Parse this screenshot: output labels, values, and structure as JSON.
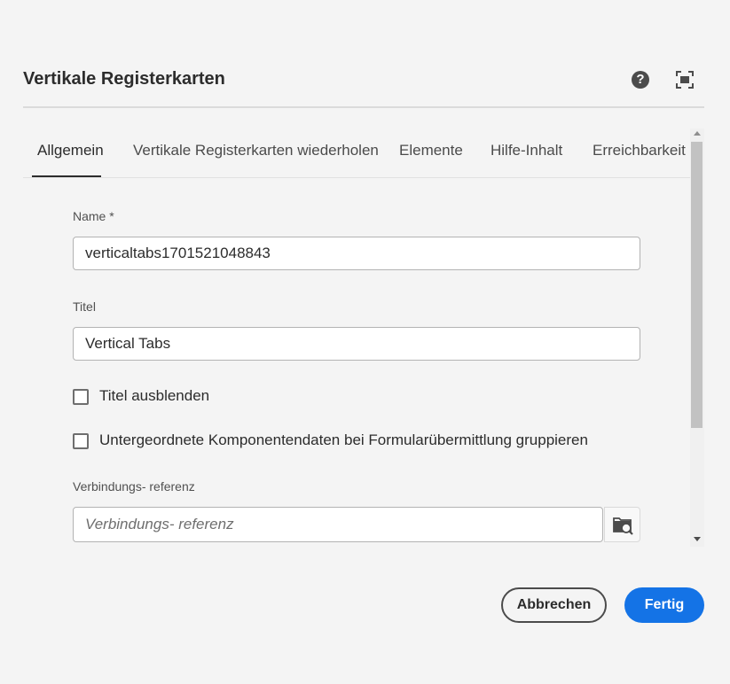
{
  "dialog": {
    "title": "Vertikale Registerkarten",
    "help_icon": "help-circle-icon",
    "fullscreen_icon": "fullscreen-icon"
  },
  "tabs": [
    {
      "label": "Allgemein",
      "active": true
    },
    {
      "label": "Vertikale Registerkarten wiederholen",
      "active": false
    },
    {
      "label": "Elemente",
      "active": false
    },
    {
      "label": "Hilfe-Inhalt",
      "active": false
    },
    {
      "label": "Erreichbarkeit",
      "active": false
    }
  ],
  "form": {
    "name": {
      "label": "Name *",
      "value": "verticaltabs1701521048843"
    },
    "title": {
      "label": "Titel",
      "value": "Vertical Tabs"
    },
    "hide_title": {
      "label": "Titel ausblenden",
      "checked": false
    },
    "group_data": {
      "label": "Untergeordnete Komponentendaten bei Formularübermittlung gruppieren",
      "checked": false
    },
    "binding_ref": {
      "label": "Verbindungs- referenz",
      "value": "",
      "placeholder": "Verbindungs- referenz",
      "browse_icon": "folder-search-icon"
    }
  },
  "footer": {
    "cancel_label": "Abbrechen",
    "done_label": "Fertig"
  },
  "colors": {
    "accent": "#1473e6",
    "background": "#f4f4f4",
    "text": "#2c2c2c"
  }
}
